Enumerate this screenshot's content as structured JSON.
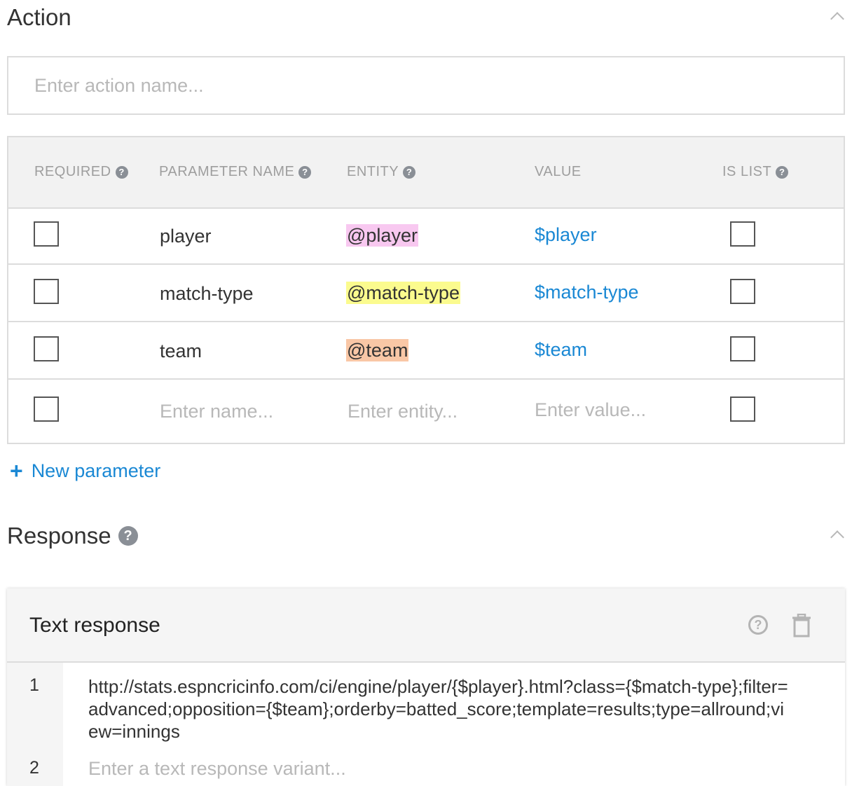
{
  "action": {
    "title": "Action",
    "name_placeholder": "Enter action name..."
  },
  "params_table": {
    "headers": {
      "required": "REQUIRED",
      "parameter_name": "PARAMETER NAME",
      "entity": "ENTITY",
      "value": "VALUE",
      "is_list": "IS LIST"
    },
    "rows": [
      {
        "name": "player",
        "entity": "@player",
        "entity_color": "#f8c8f0",
        "value": "$player",
        "required": false,
        "is_list": false
      },
      {
        "name": "match-type",
        "entity": "@match-type",
        "entity_color": "#fbfb8e",
        "value": "$match-type",
        "required": false,
        "is_list": false
      },
      {
        "name": "team",
        "entity": "@team",
        "entity_color": "#f9c7a6",
        "value": "$team",
        "required": false,
        "is_list": false
      }
    ],
    "new_row": {
      "name_placeholder": "Enter name...",
      "entity_placeholder": "Enter entity...",
      "value_placeholder": "Enter value..."
    },
    "new_parameter_label": "New parameter"
  },
  "response": {
    "title": "Response",
    "card_title": "Text response",
    "lines": [
      {
        "num": "1",
        "text": "http://stats.espncricinfo.com/ci/engine/player/{$player}.html?class={$match-type};filter=advanced;opposition={$team};orderby=batted_score;template=results;type=allround;view=innings"
      },
      {
        "num": "2",
        "placeholder": "Enter a text response variant..."
      }
    ]
  },
  "colors": {
    "accent": "#1a88d4",
    "border": "#dcdcdc",
    "header_bg": "#f2f2f2"
  }
}
